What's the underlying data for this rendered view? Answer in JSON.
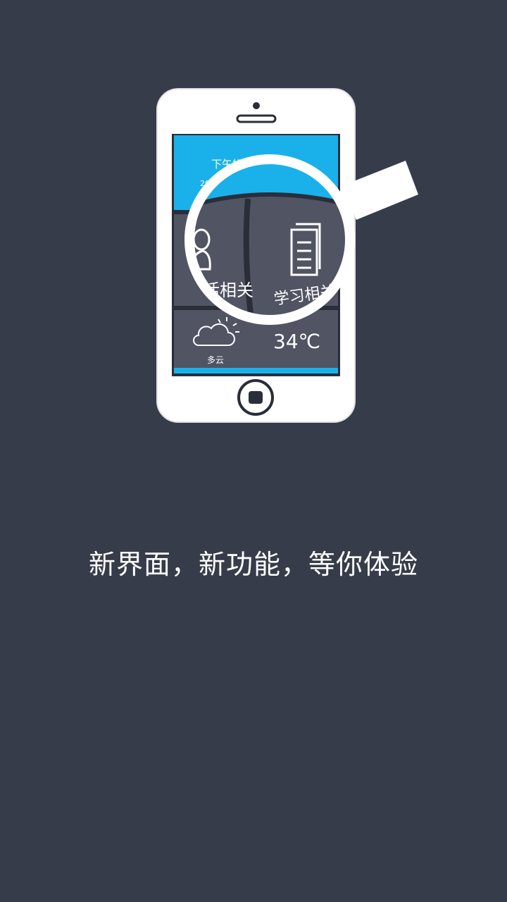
{
  "colors": {
    "background": "#373c4a",
    "phone_body": "#ffffff",
    "screen_header": "#1ab1ea",
    "tile": "#505463",
    "tile_dark": "#3a3e4b"
  },
  "phone_screen": {
    "greeting": "下午好",
    "date": "2014年08月24日 星期日",
    "tiles": {
      "life_label": "生活相关",
      "study_label": "学习相关",
      "weather_label": "多云",
      "temperature": "34℃"
    }
  },
  "icons": [
    "person-icon",
    "document-icon",
    "cloud-sun-icon",
    "magnifier-icon",
    "home-button-icon",
    "speaker-icon"
  ],
  "tagline": "新界面，新功能，等你体验"
}
